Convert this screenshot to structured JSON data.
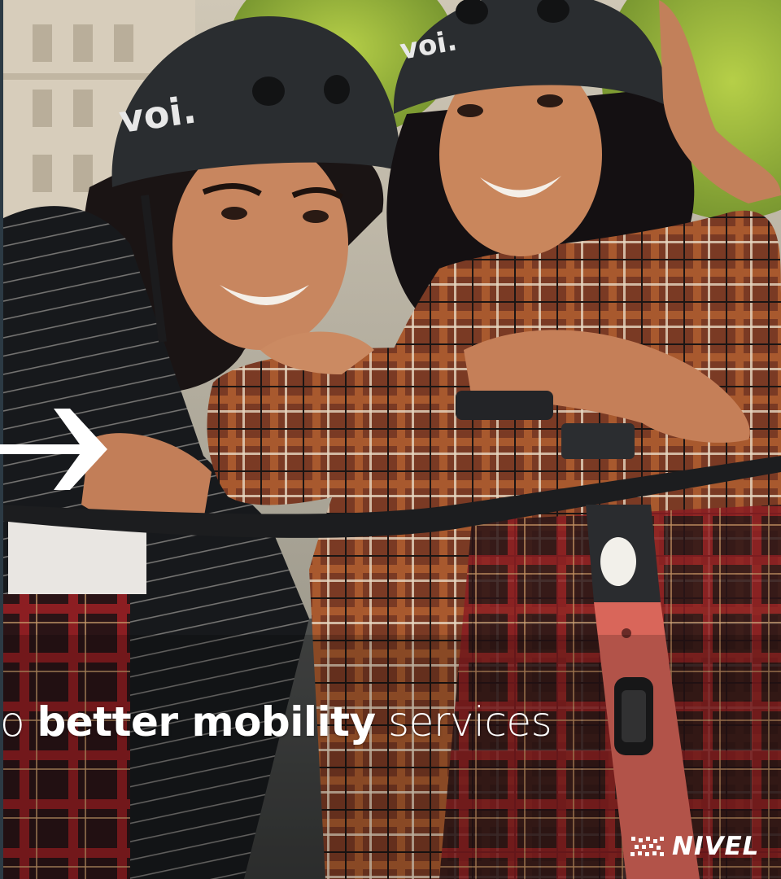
{
  "tagline": {
    "lead": "o ",
    "bold": "better mobility",
    "tail": " services"
  },
  "brand": {
    "name": "NIVEL",
    "mark": "dotted-logo-icon"
  },
  "photo": {
    "helmet_text": "voi."
  },
  "colors": {
    "text": "#ffffff",
    "scooter_stem": "#d9665a",
    "helmet": "#2a2d30"
  }
}
